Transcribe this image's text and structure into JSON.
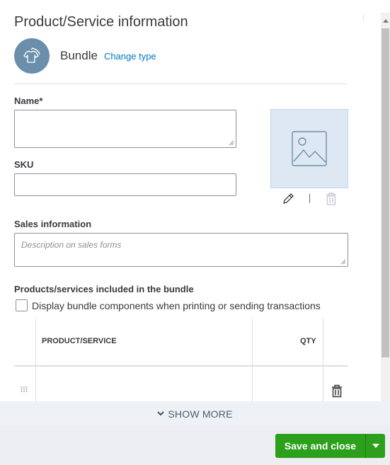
{
  "panel": {
    "title": "Product/Service information"
  },
  "type": {
    "name": "Bundle",
    "change_label": "Change type",
    "icon": "bundle-shirt-icon"
  },
  "fields": {
    "name_label": "Name*",
    "name_value": "",
    "sku_label": "SKU",
    "sku_value": "",
    "sales_label": "Sales information",
    "sales_placeholder": "Description on sales forms"
  },
  "image": {
    "icon": "image-placeholder-icon",
    "edit_icon": "pencil-icon",
    "separator": "|",
    "delete_icon": "trash-icon"
  },
  "bundle": {
    "section_label": "Products/services included in the bundle",
    "checkbox_label": "Display bundle components when printing or sending transactions",
    "checkbox_checked": false,
    "columns": [
      "PRODUCT/SERVICE",
      "QTY"
    ],
    "rows": [
      {
        "product": "",
        "qty": ""
      }
    ]
  },
  "show_more": {
    "label": "SHOW MORE",
    "icon": "chevron-down-icon"
  },
  "footer": {
    "save_label": "Save and close",
    "dropdown_icon": "caret-down-icon"
  },
  "colors": {
    "accent_link": "#0077c5",
    "primary_button": "#2ca01c",
    "type_icon_bg": "#6b8fab",
    "image_box_bg": "#dee8f2"
  }
}
